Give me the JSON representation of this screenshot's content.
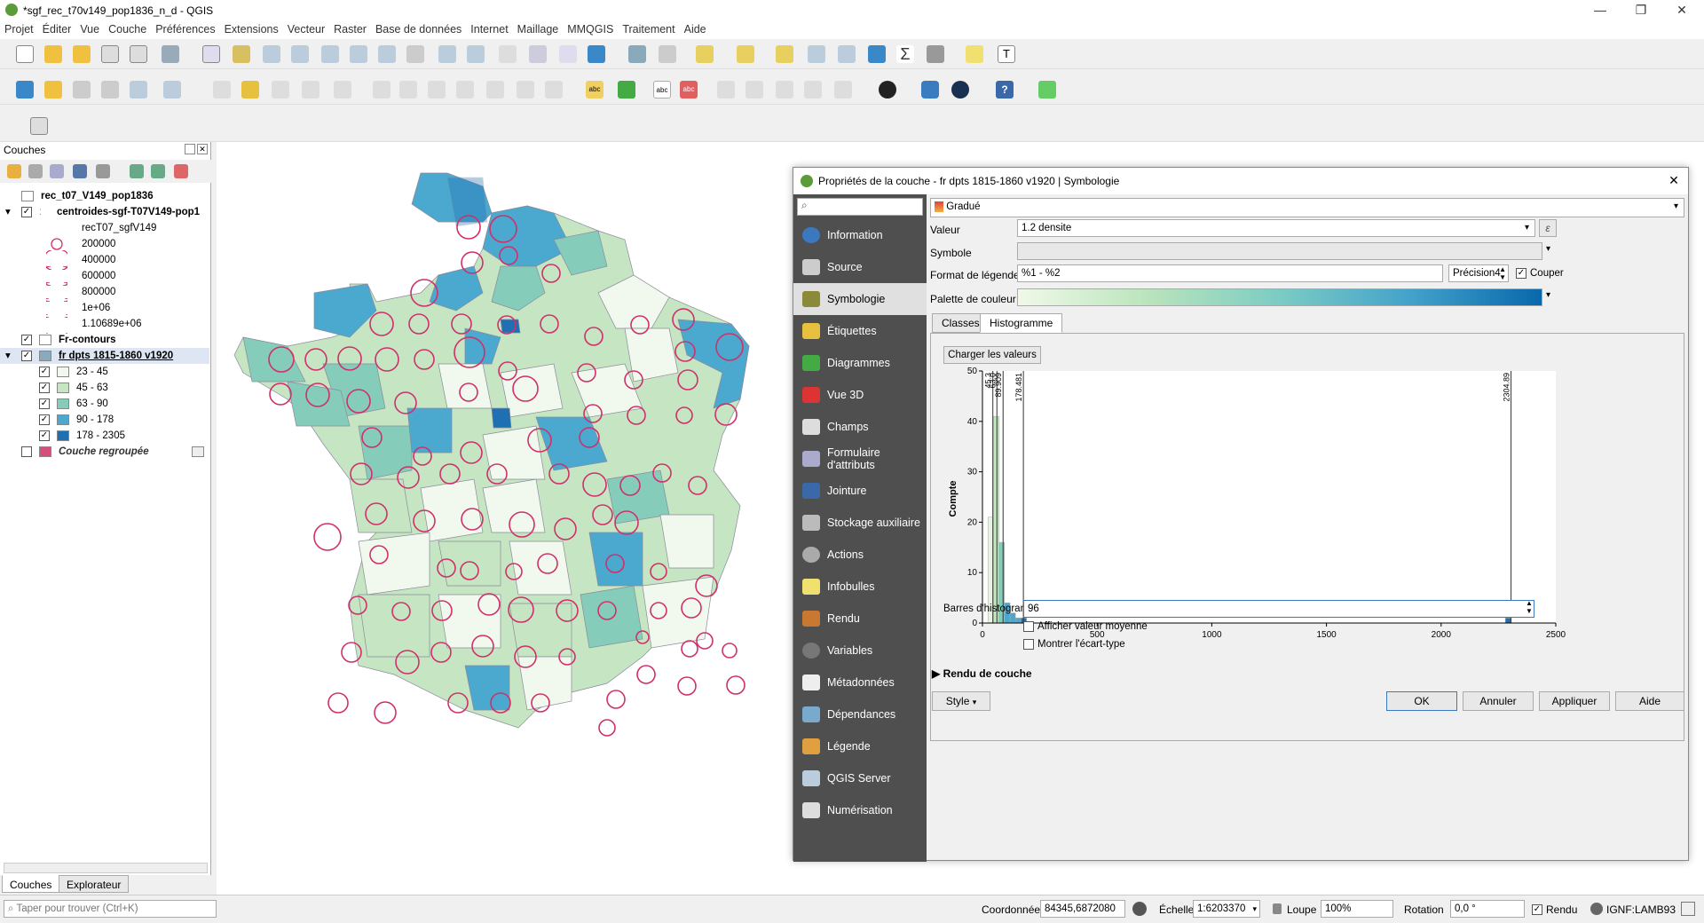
{
  "app": {
    "title": "*sgf_rec_t70v149_pop1836_n_d - QGIS",
    "menus": [
      "Projet",
      "Éditer",
      "Vue",
      "Couche",
      "Préférences",
      "Extensions",
      "Vecteur",
      "Raster",
      "Base de données",
      "Internet",
      "Maillage",
      "MMQGIS",
      "Traitement",
      "Aide"
    ]
  },
  "layers_panel": {
    "title": "Couches",
    "items": [
      {
        "label": "rec_t07_V149_pop1836",
        "bold": true
      },
      {
        "label": "centroides-sgf-T07V149-pop1",
        "bold": true
      },
      {
        "label": "recT07_sgfV149"
      },
      {
        "label": "200000"
      },
      {
        "label": "400000"
      },
      {
        "label": "600000"
      },
      {
        "label": "800000"
      },
      {
        "label": "1e+06"
      },
      {
        "label": "1.10689e+06"
      },
      {
        "label": "Fr-contours",
        "bold": true
      },
      {
        "label": "fr dpts 1815-1860 v1920",
        "bold": true
      },
      {
        "label": "23 - 45",
        "color": "#f1f9ee"
      },
      {
        "label": "45 - 63",
        "color": "#c5e5c3"
      },
      {
        "label": "63 - 90",
        "color": "#85ccbb"
      },
      {
        "label": "90 - 178",
        "color": "#4ba8cf"
      },
      {
        "label": "178 - 2305",
        "color": "#1f6fb3"
      },
      {
        "label": "Couche regroupée",
        "italic": true,
        "color": "#d54f7d"
      }
    ],
    "tabs": [
      "Couches",
      "Explorateur"
    ]
  },
  "dialog": {
    "title": "Propriétés de la couche - fr dpts 1815-1860 v1920 | Symbologie",
    "nav": [
      "Information",
      "Source",
      "Symbologie",
      "Étiquettes",
      "Diagrammes",
      "Vue 3D",
      "Champs",
      "Formulaire d'attributs",
      "Jointure",
      "Stockage auxiliaire",
      "Actions",
      "Infobulles",
      "Rendu",
      "Variables",
      "Métadonnées",
      "Dépendances",
      "Légende",
      "QGIS Server",
      "Numérisation"
    ],
    "nav_selected": "Symbologie",
    "renderer": "Gradué",
    "valeur_label": "Valeur",
    "valeur": "1.2 densite",
    "symbole_label": "Symbole",
    "format_label": "Format de légende",
    "format": "%1 - %2",
    "precision": "Précision4",
    "couper": "Couper",
    "palette_label": "Palette de couleur",
    "tabs": [
      "Classes",
      "Histogramme"
    ],
    "load_values": "Charger les valeurs",
    "histo_bars_label": "Barres d'histogramme",
    "histo_bars": "96",
    "show_mean": "Afficher valeur moyenne",
    "show_std": "Montrer l'écart-type",
    "render_section": "Rendu de couche",
    "style_btn": "Style",
    "ok": "OK",
    "cancel": "Annuler",
    "apply": "Appliquer",
    "help": "Aide"
  },
  "chart_data": {
    "type": "bar",
    "ylabel": "Compte",
    "xlim": [
      0,
      2500
    ],
    "ylim": [
      0,
      50
    ],
    "xticks": [
      0,
      500,
      1000,
      1500,
      2000,
      2500
    ],
    "yticks": [
      0,
      10,
      20,
      30,
      40,
      50
    ],
    "bins": [
      {
        "x": 36,
        "y": 21,
        "color": "#e6f4e1"
      },
      {
        "x": 60,
        "y": 41,
        "color": "#c5e5c3"
      },
      {
        "x": 84,
        "y": 16,
        "color": "#85ccbb"
      },
      {
        "x": 108,
        "y": 4,
        "color": "#4ba8cf"
      },
      {
        "x": 132,
        "y": 2,
        "color": "#4ba8cf"
      },
      {
        "x": 156,
        "y": 1,
        "color": "#4ba8cf"
      },
      {
        "x": 180,
        "y": 1,
        "color": "#1f6fb3"
      },
      {
        "x": 2292,
        "y": 1,
        "color": "#1f6fb3"
      }
    ],
    "breaks": [
      {
        "value": 45.3,
        "label": "45.3"
      },
      {
        "value": 63.0,
        "label": "63.0"
      },
      {
        "value": 89.909,
        "label": "89.909"
      },
      {
        "value": 178.481,
        "label": "178.481"
      },
      {
        "value": 2304.89,
        "label": "2304.89"
      }
    ]
  },
  "status": {
    "search_placeholder": "Taper pour trouver (Ctrl+K)",
    "coord_label": "Coordonnée",
    "coord": "84345,6872080",
    "scale_label": "Échelle",
    "scale": "1:6203370",
    "loupe_label": "Loupe",
    "loupe": "100%",
    "rotation_label": "Rotation",
    "rotation": "0,0 °",
    "render_label": "Rendu",
    "crs": "IGNF:LAMB93"
  }
}
